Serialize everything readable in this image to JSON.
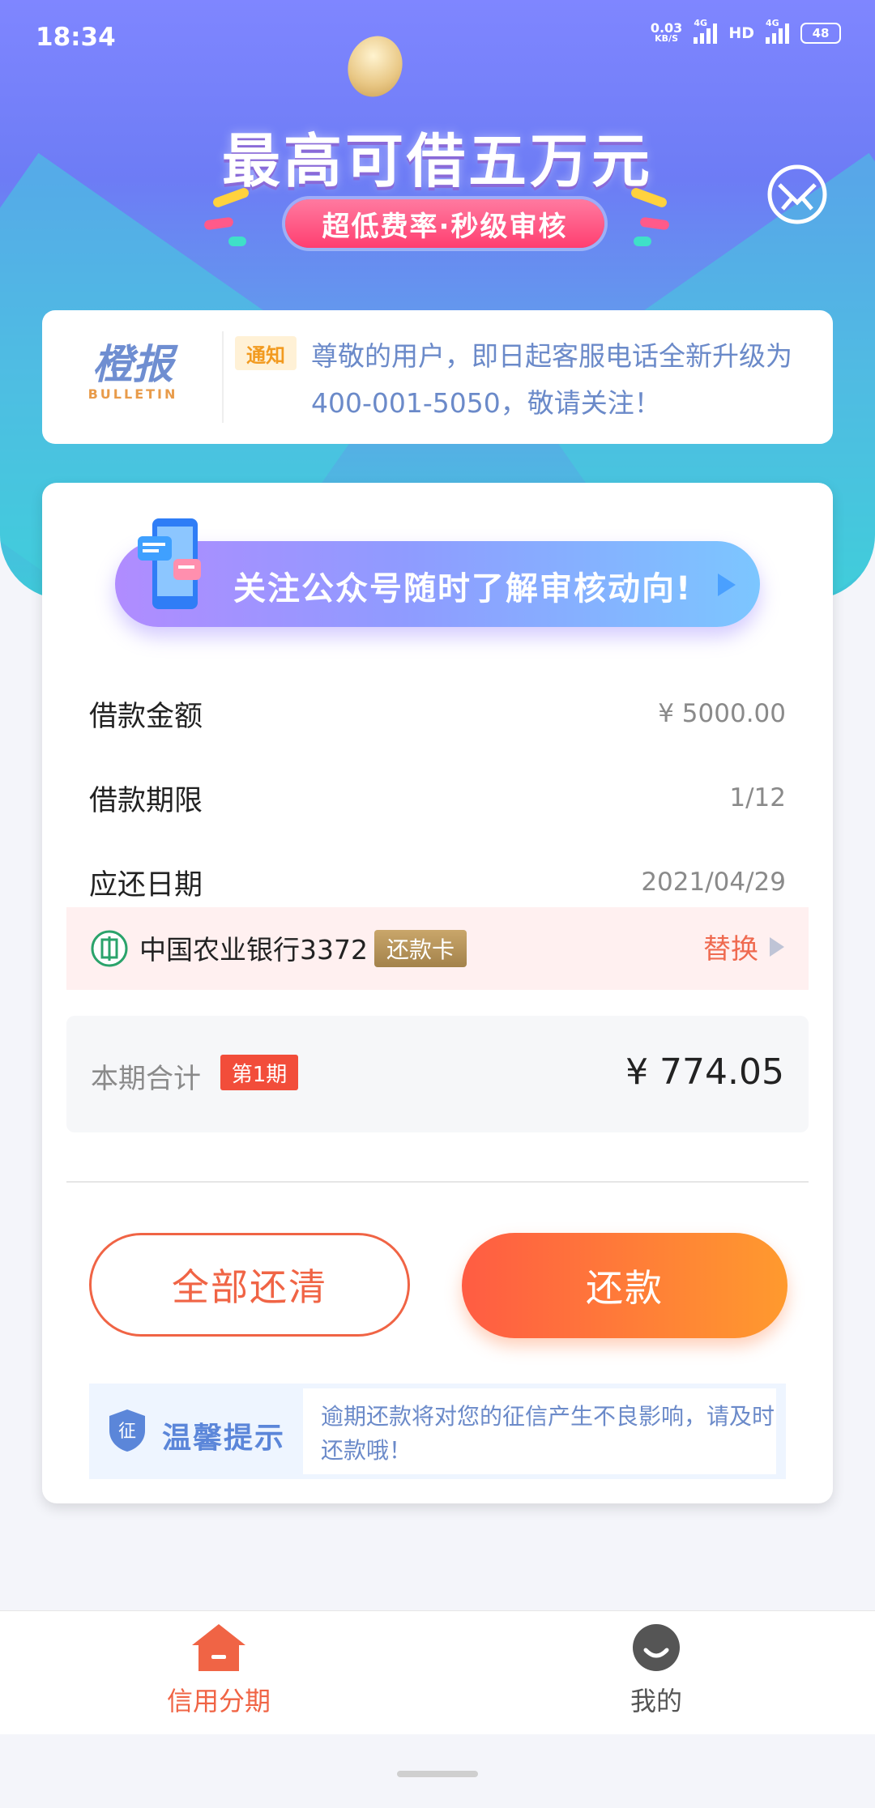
{
  "status_bar": {
    "time": "18:34",
    "net_speed": "0.03",
    "net_unit": "KB/S",
    "net1": "4G",
    "hd": "HD",
    "net2": "4G",
    "battery": "48"
  },
  "hero": {
    "headline": "最高可借五万元",
    "subtitle": "超低费率·秒级审核"
  },
  "bulletin": {
    "logo_cn": "橙报",
    "logo_en": "BULLETIN",
    "tag": "通知",
    "text": "尊敬的用户，即日起客服电话全新升级为400-001-5050，敬请关注！"
  },
  "card": {
    "banner_text": "关注公众号随时了解审核动向!",
    "rows": [
      {
        "label": "借款金额",
        "value": "¥ 5000.00"
      },
      {
        "label": "借款期限",
        "value": "1/12"
      },
      {
        "label": "应还日期",
        "value": "2021/04/29"
      }
    ],
    "bank": {
      "name": "中国农业银行3372",
      "tag": "还款卡",
      "swap_label": "替换"
    },
    "total": {
      "label": "本期合计",
      "badge": "第1期",
      "amount": "¥ 774.05"
    },
    "buttons": {
      "pay_all": "全部还清",
      "pay": "还款"
    },
    "tip": {
      "title": "温馨提示",
      "text": "逾期还款将对您的征信产生不良影响，请及时还款哦！",
      "shield_char": "征"
    }
  },
  "tabs": [
    {
      "label": "信用分期",
      "icon": "home-icon",
      "active": true,
      "color": "#f06445"
    },
    {
      "label": "我的",
      "icon": "user-icon",
      "active": false,
      "color": "#555555"
    }
  ],
  "colors": {
    "accent": "#f06445",
    "link_blue": "#6b8ac9"
  }
}
